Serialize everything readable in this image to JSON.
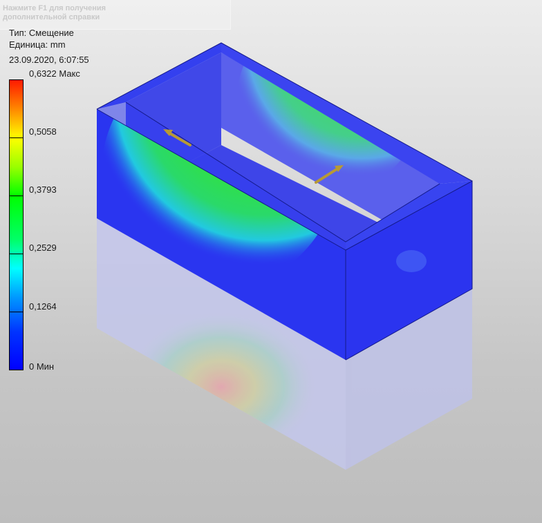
{
  "hint": {
    "line1": "Нажмите F1 для получения",
    "line2": "дополнительной справки"
  },
  "result_info": {
    "type_label": "Тип: Смещение",
    "unit_label": "Единица: mm",
    "timestamp": "23.09.2020, 6:07:55"
  },
  "legend": {
    "labels": [
      "0,6322 Макс",
      "0,5058",
      "0,3793",
      "0,2529",
      "0,1264",
      "0 Мин"
    ],
    "colors": [
      "#ff0000",
      "#ffff00",
      "#00ff00",
      "#00ffff",
      "#0000ff"
    ]
  },
  "model": {
    "body_color": "#2a35f0",
    "hot_color": "#ff2a10",
    "mid_color": "#30e030",
    "load_arrow_color": "#b79a35"
  }
}
